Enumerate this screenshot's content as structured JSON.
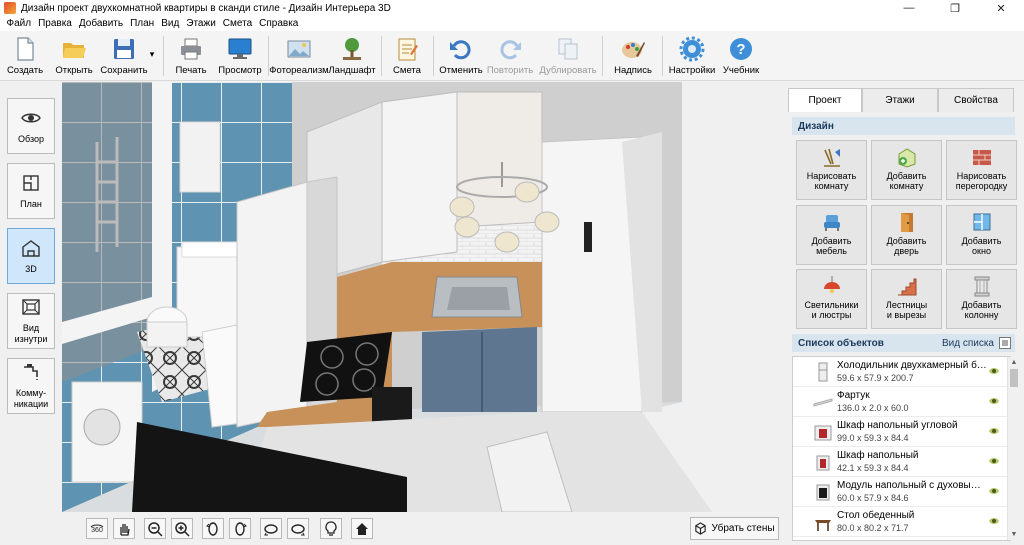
{
  "window": {
    "title": "Дизайн проект двухкомнатной квартиры в сканди стиле - Дизайн Интерьера 3D",
    "minimize": "—",
    "maximize": "❐",
    "close": "✕"
  },
  "menu": [
    "Файл",
    "Правка",
    "Добавить",
    "План",
    "Вид",
    "Этажи",
    "Смета",
    "Справка"
  ],
  "toolbar": {
    "create": "Создать",
    "open": "Открыть",
    "save": "Сохранить",
    "save_dropdown": "▾",
    "print": "Печать",
    "preview": "Просмотр",
    "photorealism": "Фотореализм",
    "landscape": "Ландшафт",
    "estimate": "Смета",
    "undo": "Отменить",
    "redo": "Повторить",
    "duplicate": "Дублировать",
    "caption": "Надпись",
    "settings": "Настройки",
    "tutorial": "Учебник"
  },
  "left_panel": {
    "overview": "Обзор",
    "plan": "План",
    "view3d": "3D",
    "inside": "Вид\nизнутри",
    "communications": "Комму-\nникации"
  },
  "viewport_bar": {
    "remove_walls": "Убрать стены"
  },
  "right_panel": {
    "tabs": [
      "Проект",
      "Этажи",
      "Свойства"
    ],
    "design_header": "Дизайн",
    "design_buttons": [
      "Нарисовать\nкомнату",
      "Добавить\nкомнату",
      "Нарисовать\nперегородку",
      "Добавить\nмебель",
      "Добавить\nдверь",
      "Добавить\nокно",
      "Светильники\nи люстры",
      "Лестницы\nи вырезы",
      "Добавить\nколонну"
    ],
    "objects_header": "Список объектов",
    "list_view": "Вид списка",
    "objects": [
      {
        "name": "Холодильник двухкамерный бе...",
        "dims": "59.6 x 57.9 x 200.7"
      },
      {
        "name": "Фартук",
        "dims": "136.0 x 2.0 x 60.0"
      },
      {
        "name": "Шкаф напольный угловой",
        "dims": "99.0 x 59.3 x 84.4"
      },
      {
        "name": "Шкаф напольный",
        "dims": "42.1 x 59.3 x 84.4"
      },
      {
        "name": "Модуль напольный с духовым ...",
        "dims": "60.0 x 57.9 x 84.6"
      },
      {
        "name": "Стол обеденный",
        "dims": "80.0 x 80.2 x 71.7"
      }
    ]
  },
  "colors": {
    "accent_tab_header": "#d8e4ee",
    "active_view_button": "#cfe6fb",
    "tile_blue": "#5f93b2",
    "countertop": "#c8915a",
    "cabinet_front": "#5f7691"
  }
}
